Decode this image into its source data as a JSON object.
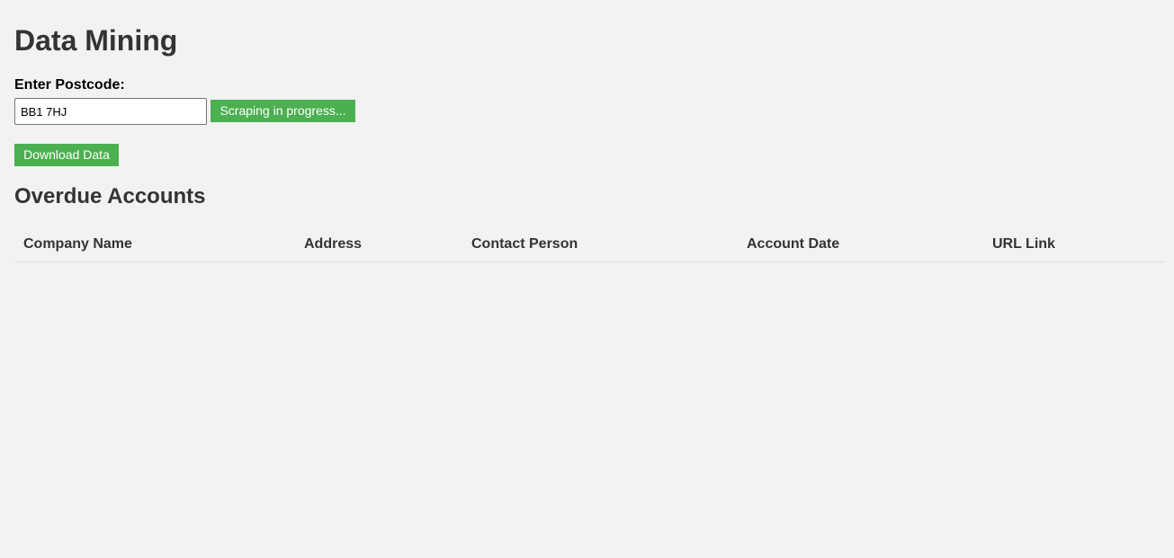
{
  "page": {
    "title": "Data Mining"
  },
  "form": {
    "postcode_label": "Enter Postcode:",
    "postcode_value": "BB1 7HJ",
    "scrape_button_label": "Scraping in progress...",
    "download_button_label": "Download Data"
  },
  "section": {
    "title": "Overdue Accounts"
  },
  "table": {
    "columns": [
      "Company Name",
      "Address",
      "Contact Person",
      "Account Date",
      "URL Link"
    ],
    "rows": []
  },
  "colors": {
    "background": "#f2f2f2",
    "button": "#4caf50",
    "heading": "#333333"
  }
}
